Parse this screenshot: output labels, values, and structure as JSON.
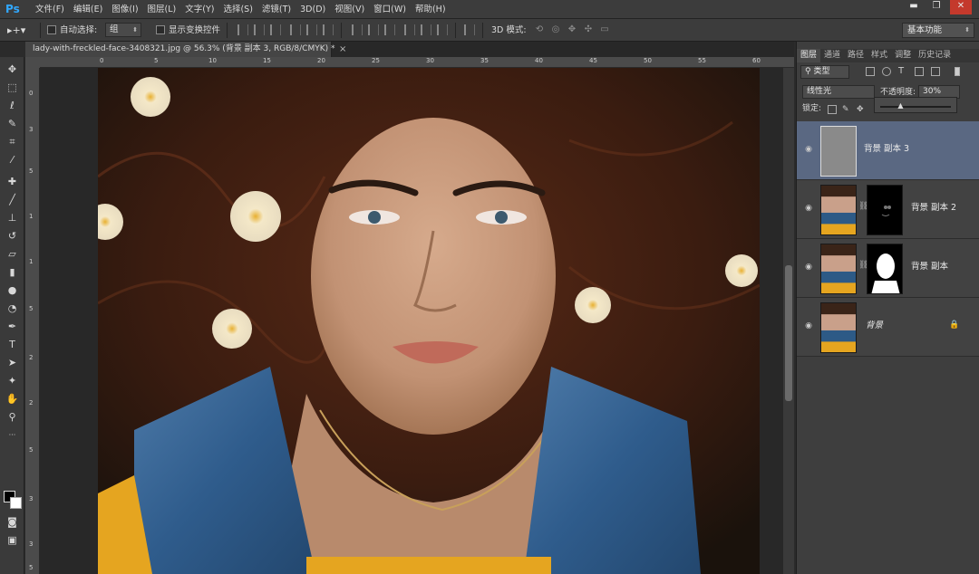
{
  "app": {
    "logo": "Ps"
  },
  "menu": [
    "文件(F)",
    "编辑(E)",
    "图像(I)",
    "图层(L)",
    "文字(Y)",
    "选择(S)",
    "滤镜(T)",
    "3D(D)",
    "视图(V)",
    "窗口(W)",
    "帮助(H)"
  ],
  "window_controls": {
    "minimize": "▬",
    "restore": "❐",
    "close": "✕"
  },
  "options": {
    "auto_select_label": "自动选择:",
    "auto_select_value": "组",
    "show_transform_label": "显示变换控件",
    "mode_3d_label": "3D 模式:",
    "workspace": "基本功能"
  },
  "document": {
    "tab_title": "lady-with-freckled-face-3408321.jpg @ 56.3% (背景 副本 3, RGB/8/CMYK) *",
    "close": "×"
  },
  "rulers": {
    "h_labels": [
      "0",
      "5",
      "10",
      "15",
      "20",
      "25",
      "30",
      "35",
      "40",
      "45",
      "50",
      "55",
      "60"
    ],
    "v_labels": [
      "0",
      "3",
      "5",
      "1",
      "1",
      "5",
      "2",
      "2",
      "5",
      "3",
      "3",
      "5"
    ]
  },
  "panel": {
    "tabs": [
      "图层",
      "通道",
      "路径",
      "样式",
      "调整",
      "历史记录"
    ],
    "filter_type": "类型",
    "blend_mode": "线性光",
    "opacity_label": "不透明度:",
    "opacity_value": "30%",
    "lock_label": "锁定:",
    "opacity_slider_fraction": 0.3
  },
  "layers": [
    {
      "name": "背景 副本 3",
      "selected": true,
      "has_mask": false,
      "locked": false
    },
    {
      "name": "背景 副本 2",
      "selected": false,
      "has_mask": true,
      "locked": false
    },
    {
      "name": "背景 副本",
      "selected": false,
      "has_mask": true,
      "locked": false
    },
    {
      "name": "背景",
      "selected": false,
      "has_mask": false,
      "locked": true
    }
  ],
  "tools": [
    "move-tool",
    "marquee-tool",
    "lasso-tool",
    "quick-select-tool",
    "crop-tool",
    "eyedropper-tool",
    "healing-brush-tool",
    "brush-tool",
    "clone-stamp-tool",
    "history-brush-tool",
    "eraser-tool",
    "gradient-tool",
    "blur-tool",
    "dodge-tool",
    "pen-tool",
    "type-tool",
    "path-select-tool",
    "shape-tool",
    "hand-tool",
    "zoom-tool"
  ]
}
